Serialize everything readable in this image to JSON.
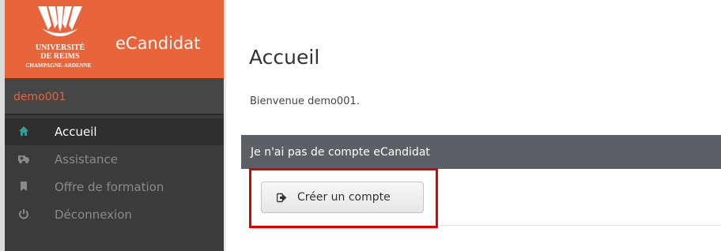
{
  "header": {
    "university_line1": "UNIVERSITÉ",
    "university_line2": "DE REIMS",
    "university_line3": "CHAMPAGNE-ARDENNE",
    "app_title": "eCandidat",
    "brand_color": "#e8643a"
  },
  "user": {
    "name": "demo001"
  },
  "sidebar": {
    "items": [
      {
        "label": "Accueil",
        "icon": "home-icon",
        "active": true
      },
      {
        "label": "Assistance",
        "icon": "ambulance-icon",
        "active": false
      },
      {
        "label": "Offre de formation",
        "icon": "bookmark-icon",
        "active": false
      },
      {
        "label": "Déconnexion",
        "icon": "power-icon",
        "active": false
      }
    ]
  },
  "main": {
    "title": "Accueil",
    "welcome": "Bienvenue demo001.",
    "panel": {
      "title": "Je n'ai pas de compte eCandidat",
      "button_label": "Créer un compte",
      "button_icon": "sign-in-icon"
    }
  },
  "annotation": {
    "highlight_color": "#e00000"
  }
}
